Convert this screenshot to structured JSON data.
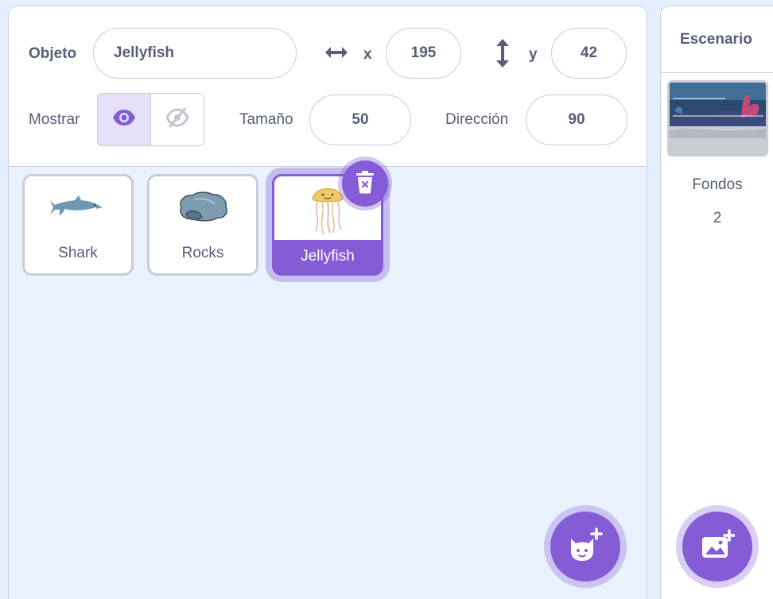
{
  "sprite_info": {
    "sprite_label": "Objeto",
    "sprite_name": "Jellyfish",
    "x_label": "x",
    "x_value": "195",
    "y_label": "y",
    "y_value": "42",
    "show_label": "Mostrar",
    "size_label": "Tamaño",
    "size_value": "50",
    "direction_label": "Dirección",
    "direction_value": "90",
    "visible": true
  },
  "sprites": [
    {
      "name": "Shark",
      "icon": "shark-thumbnail",
      "selected": false
    },
    {
      "name": "Rocks",
      "icon": "rocks-thumbnail",
      "selected": false
    },
    {
      "name": "Jellyfish",
      "icon": "jellyfish-thumbnail",
      "selected": true
    }
  ],
  "stage": {
    "title": "Escenario",
    "backdrops_label": "Fondos",
    "backdrops_count": "2"
  },
  "icons": {
    "delete": "trash-icon",
    "add_sprite": "cat-plus-icon",
    "add_backdrop": "image-plus-icon",
    "show": "eye-icon",
    "hide": "eye-slash-icon",
    "x_arrows": "horizontal-arrows-icon",
    "y_arrows": "vertical-arrows-icon"
  },
  "colors": {
    "accent": "#855cd6",
    "text": "#575e75",
    "pane_bg": "#e9f1fc",
    "border": "#c9ccd6"
  }
}
